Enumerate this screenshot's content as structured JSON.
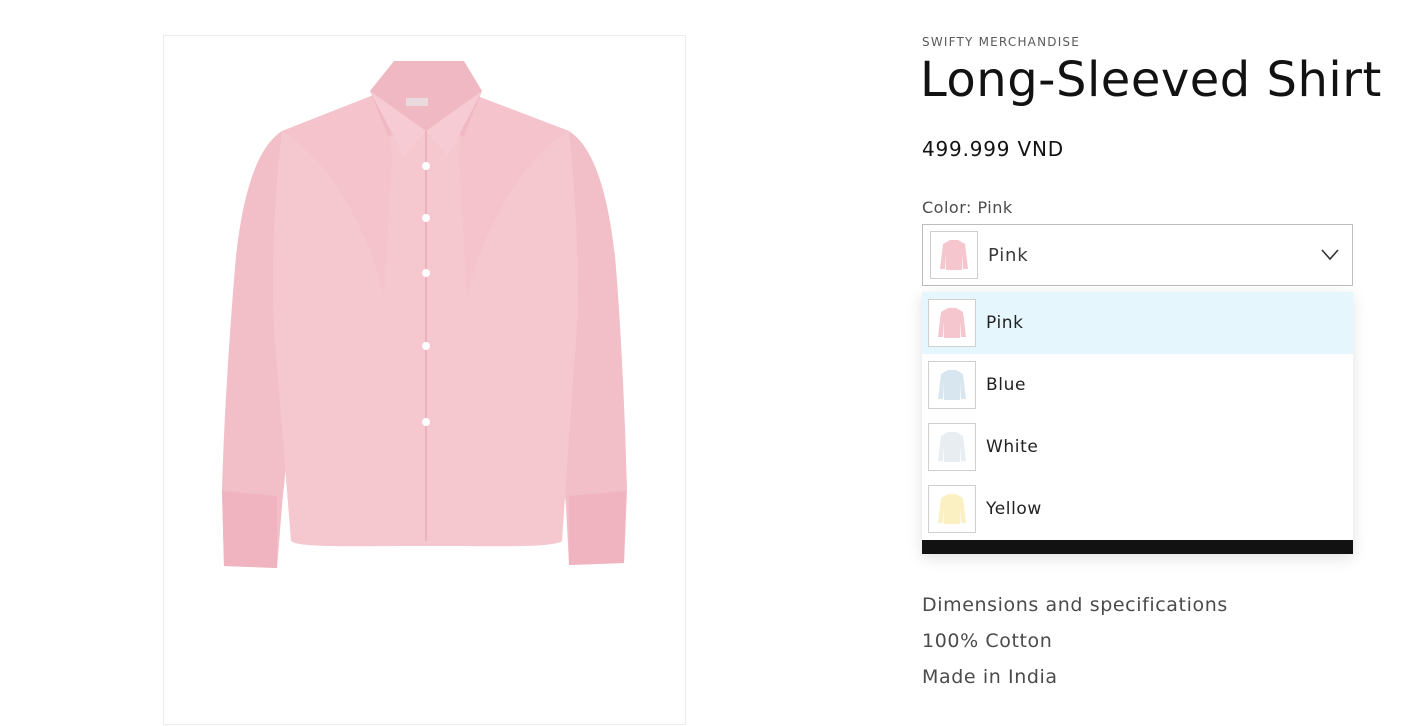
{
  "product": {
    "vendor": "SWIFTY MERCHANDISE",
    "title": "Long-Sleeved Shirt",
    "price": "499.999 VND"
  },
  "variant": {
    "label": "Color: Pink",
    "selected": "Pink",
    "options": [
      {
        "label": "Pink",
        "swatch": "#f6c6cf",
        "active": true
      },
      {
        "label": "Blue",
        "swatch": "#d8e6f0",
        "active": false
      },
      {
        "label": "White",
        "swatch": "#e8edf2",
        "active": false
      },
      {
        "label": "Yellow",
        "swatch": "#fbf0c2",
        "active": false
      }
    ]
  },
  "details": {
    "heading": "Dimensions and specifications",
    "material": "100% Cotton",
    "origin": "Made in India"
  },
  "icons": {
    "select_caret": "chevron-down-icon"
  }
}
